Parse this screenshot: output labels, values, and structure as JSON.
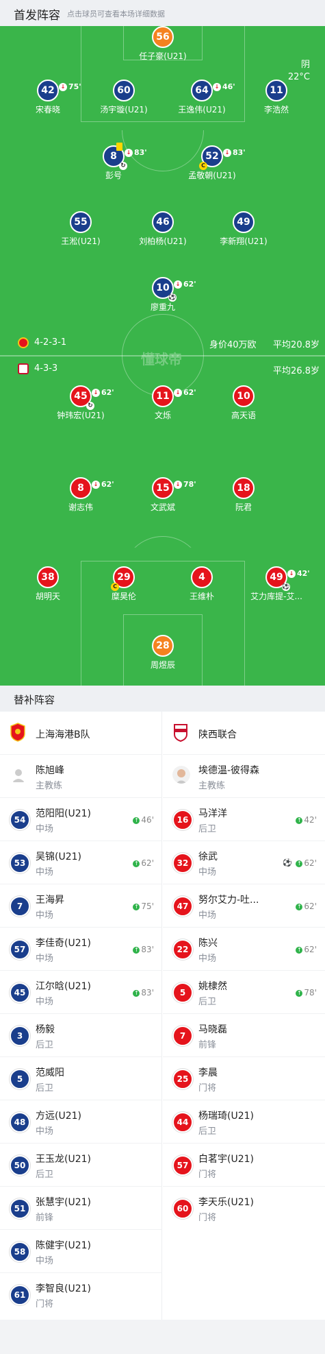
{
  "header": {
    "title": "首发阵容",
    "subtitle": "点击球员可查看本场详细数据"
  },
  "weather": {
    "condition": "阴",
    "temp": "22°C"
  },
  "watermark": "懂球帝",
  "home_team": {
    "formation": "4-2-3-1",
    "value": "身价40万欧",
    "avg_age": "平均20.8岁"
  },
  "away_team": {
    "formation": "4-3-3",
    "avg_age": "平均26.8岁"
  },
  "home_players": [
    {
      "num": "56",
      "name": "任子豪(U21)",
      "gk": true
    },
    {
      "num": "42",
      "name": "宋春晓",
      "sub": "75'"
    },
    {
      "num": "60",
      "name": "汤宇璇(U21)"
    },
    {
      "num": "64",
      "name": "王逸伟(U21)",
      "sub": "46'"
    },
    {
      "num": "11",
      "name": "李浩然"
    },
    {
      "num": "8",
      "name": "彭号",
      "sub": "83'"
    },
    {
      "num": "52",
      "name": "孟敬朝(U21)",
      "sub": "83'"
    },
    {
      "num": "55",
      "name": "王淞(U21)"
    },
    {
      "num": "46",
      "name": "刘柏杨(U21)"
    },
    {
      "num": "49",
      "name": "李新翔(U21)"
    },
    {
      "num": "10",
      "name": "廖重九",
      "sub": "62'"
    }
  ],
  "away_players": [
    {
      "num": "45",
      "name": "钟玮宏(U21)",
      "sub": "62'"
    },
    {
      "num": "11",
      "name": "文烁",
      "sub": "62'"
    },
    {
      "num": "10",
      "name": "高天语"
    },
    {
      "num": "8",
      "name": "谢志伟",
      "sub": "62'"
    },
    {
      "num": "15",
      "name": "文武斌",
      "sub": "78'"
    },
    {
      "num": "18",
      "name": "阮君"
    },
    {
      "num": "38",
      "name": "胡明天"
    },
    {
      "num": "29",
      "name": "糜昊伦"
    },
    {
      "num": "4",
      "name": "王维朴"
    },
    {
      "num": "49",
      "name": "艾力库提-艾...",
      "sub": "42'"
    },
    {
      "num": "28",
      "name": "周煜辰",
      "gk": true
    }
  ],
  "subs_title": "替补阵容",
  "subs": {
    "home": {
      "team": "上海海港B队",
      "coach": {
        "name": "陈旭峰",
        "role": "主教练"
      },
      "players": [
        {
          "num": "54",
          "name": "范阳阳(U21)",
          "pos": "中场",
          "min": "46'"
        },
        {
          "num": "53",
          "name": "吴锦(U21)",
          "pos": "中场",
          "min": "62'"
        },
        {
          "num": "7",
          "name": "王海昇",
          "pos": "中场",
          "min": "75'"
        },
        {
          "num": "57",
          "name": "李佳奇(U21)",
          "pos": "中场",
          "min": "83'"
        },
        {
          "num": "45",
          "name": "江尔晗(U21)",
          "pos": "中场",
          "min": "83'"
        },
        {
          "num": "3",
          "name": "杨毅",
          "pos": "后卫"
        },
        {
          "num": "5",
          "name": "范威阳",
          "pos": "后卫"
        },
        {
          "num": "48",
          "name": "方远(U21)",
          "pos": "中场"
        },
        {
          "num": "50",
          "name": "王玉龙(U21)",
          "pos": "后卫"
        },
        {
          "num": "51",
          "name": "张慧宇(U21)",
          "pos": "前锋"
        },
        {
          "num": "58",
          "name": "陈健宇(U21)",
          "pos": "中场"
        },
        {
          "num": "61",
          "name": "李智良(U21)",
          "pos": "门将"
        }
      ]
    },
    "away": {
      "team": "陕西联合",
      "coach": {
        "name": "埃德温-彼得森",
        "role": "主教练"
      },
      "players": [
        {
          "num": "16",
          "name": "马洋洋",
          "pos": "后卫",
          "min": "42'"
        },
        {
          "num": "32",
          "name": "徐武",
          "pos": "中场",
          "min": "62'",
          "goal": true
        },
        {
          "num": "47",
          "name": "努尔艾力-吐...",
          "pos": "中场",
          "min": "62'"
        },
        {
          "num": "22",
          "name": "陈兴",
          "pos": "中场",
          "min": "62'"
        },
        {
          "num": "5",
          "name": "姚棣然",
          "pos": "后卫",
          "min": "78'"
        },
        {
          "num": "7",
          "name": "马晓磊",
          "pos": "前锋"
        },
        {
          "num": "25",
          "name": "李晨",
          "pos": "门将"
        },
        {
          "num": "44",
          "name": "杨瑞琦(U21)",
          "pos": "后卫"
        },
        {
          "num": "57",
          "name": "白茗宇(U21)",
          "pos": "门将"
        },
        {
          "num": "60",
          "name": "李天乐(U21)",
          "pos": "门将"
        }
      ]
    }
  },
  "colors": {
    "pitch": "#3ab54a",
    "home": "#1a3e8c",
    "away": "#e5141c",
    "gk": "#f5821f"
  }
}
